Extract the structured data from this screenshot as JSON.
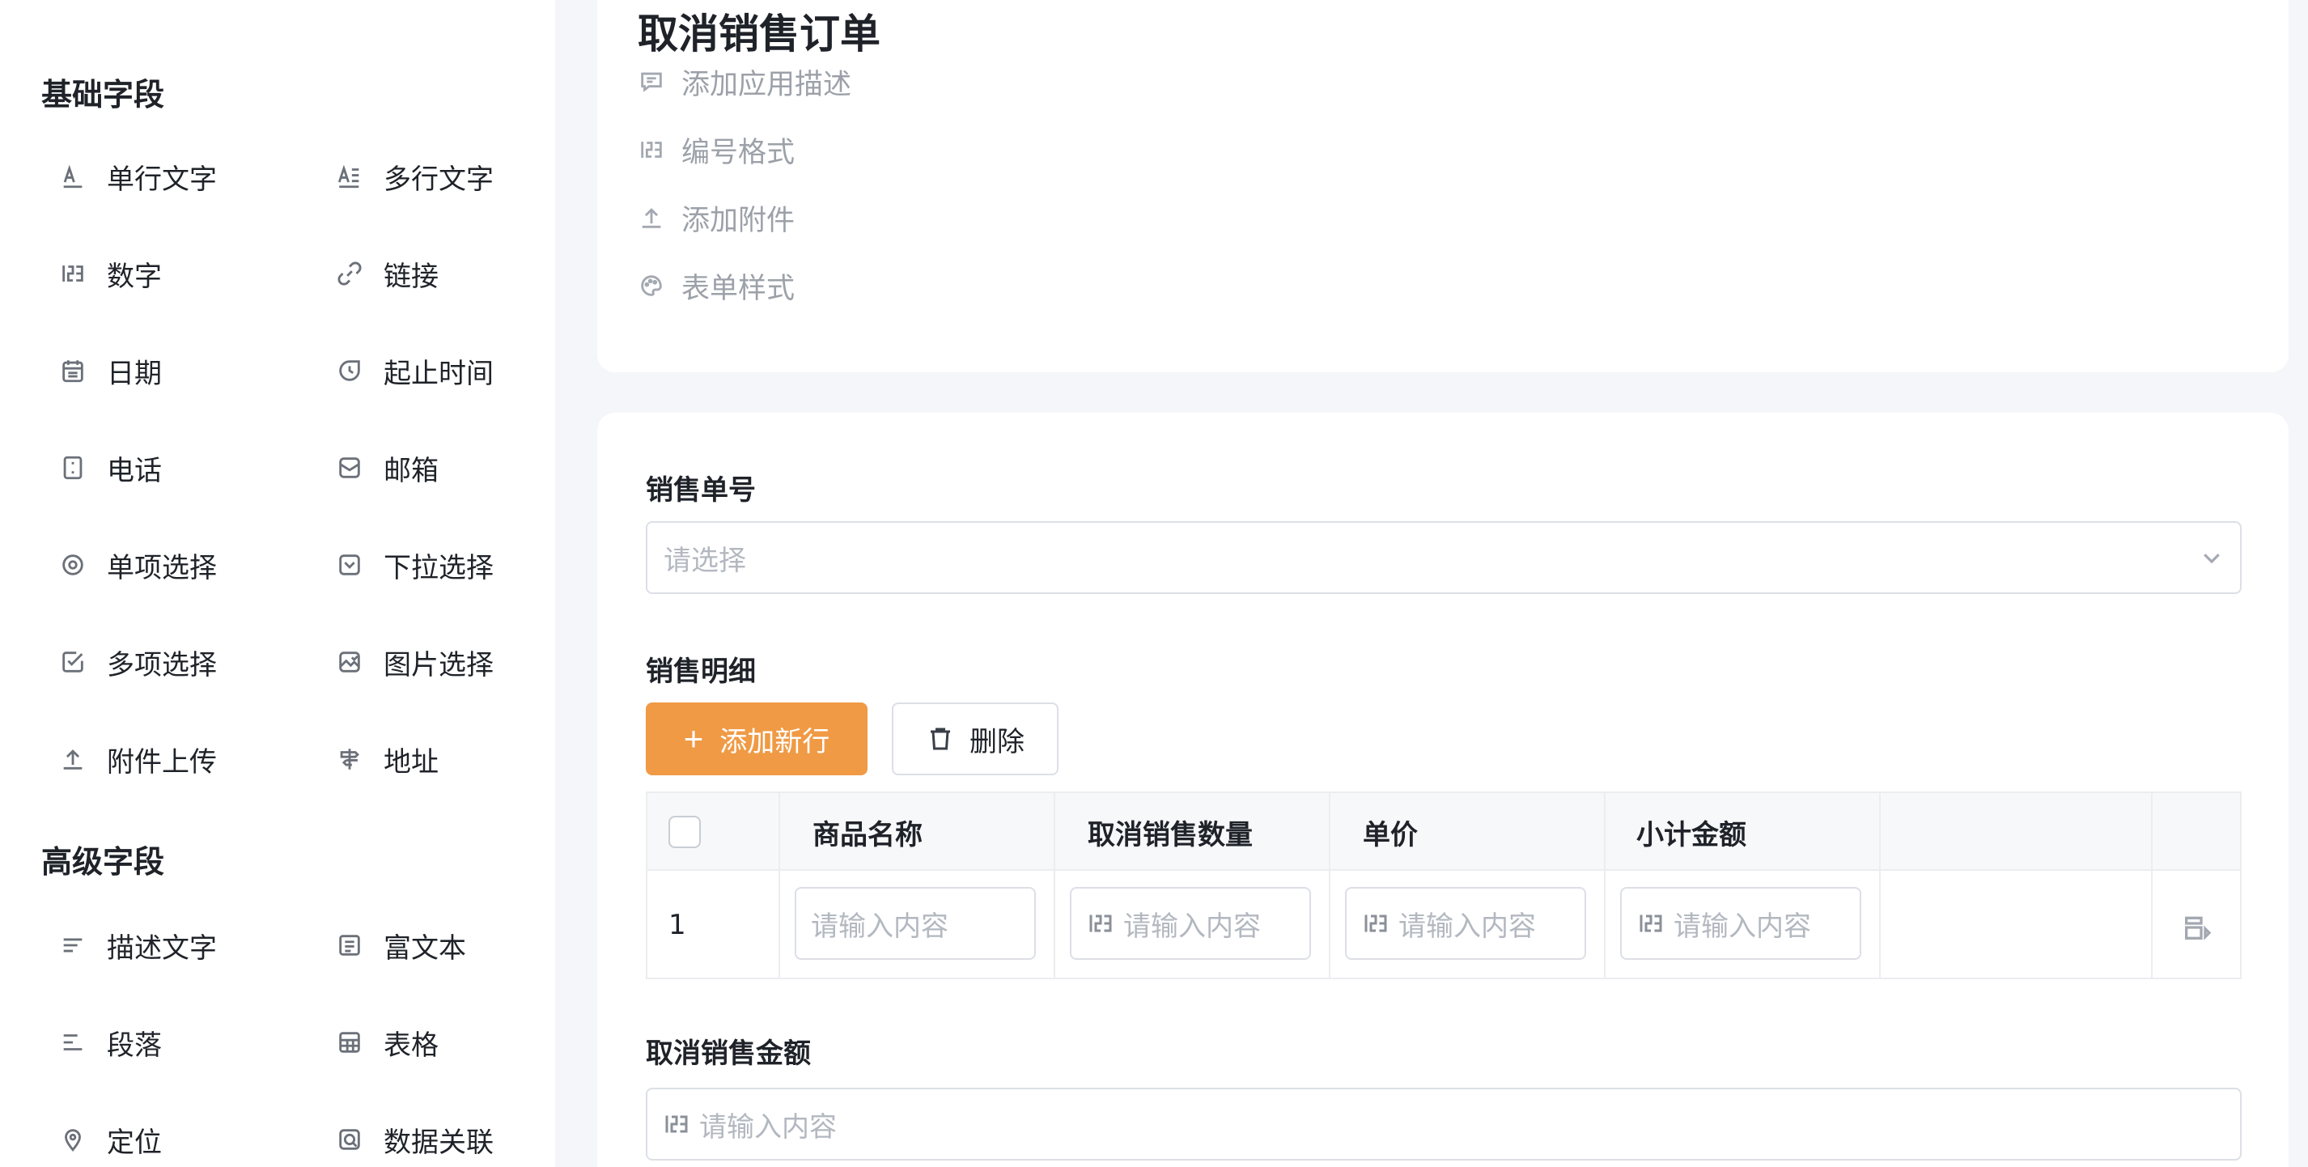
{
  "sidebar": {
    "basic_title": "基础字段",
    "basic_fields": [
      {
        "label": "单行文字",
        "icon": "single-line-text-icon"
      },
      {
        "label": "多行文字",
        "icon": "multi-line-text-icon"
      },
      {
        "label": "数字",
        "icon": "number-icon"
      },
      {
        "label": "链接",
        "icon": "link-icon"
      },
      {
        "label": "日期",
        "icon": "calendar-icon"
      },
      {
        "label": "起止时间",
        "icon": "time-range-icon"
      },
      {
        "label": "电话",
        "icon": "phone-icon"
      },
      {
        "label": "邮箱",
        "icon": "mail-icon"
      },
      {
        "label": "单项选择",
        "icon": "radio-icon"
      },
      {
        "label": "下拉选择",
        "icon": "dropdown-icon"
      },
      {
        "label": "多项选择",
        "icon": "checkbox-icon"
      },
      {
        "label": "图片选择",
        "icon": "image-icon"
      },
      {
        "label": "附件上传",
        "icon": "upload-icon"
      },
      {
        "label": "地址",
        "icon": "signpost-icon"
      }
    ],
    "advanced_title": "高级字段",
    "advanced_fields": [
      {
        "label": "描述文字",
        "icon": "description-icon"
      },
      {
        "label": "富文本",
        "icon": "rich-text-icon"
      },
      {
        "label": "段落",
        "icon": "paragraph-icon"
      },
      {
        "label": "表格",
        "icon": "table-icon"
      },
      {
        "label": "定位",
        "icon": "location-icon"
      },
      {
        "label": "数据关联",
        "icon": "data-link-icon"
      }
    ]
  },
  "app": {
    "title": "取消销售订单",
    "meta": [
      {
        "label": "添加应用描述",
        "icon": "comment-icon"
      },
      {
        "label": "编号格式",
        "icon": "number-format-icon"
      },
      {
        "label": "添加附件",
        "icon": "upload-icon"
      },
      {
        "label": "表单样式",
        "icon": "palette-icon"
      }
    ]
  },
  "form": {
    "order_no_label": "销售单号",
    "order_no_placeholder": "请选择",
    "detail_label": "销售明细",
    "add_row_label": "添加新行",
    "delete_label": "删除",
    "table_headers": [
      "商品名称",
      "取消销售数量",
      "单价",
      "小计金额"
    ],
    "row_index": "1",
    "cell_placeholder": "请输入内容",
    "amount_label": "取消销售金额",
    "amount_placeholder": "请输入内容"
  },
  "colors": {
    "accent": "#f09a45",
    "border": "#dcdfe6",
    "placeholder": "#b3b8c0"
  }
}
